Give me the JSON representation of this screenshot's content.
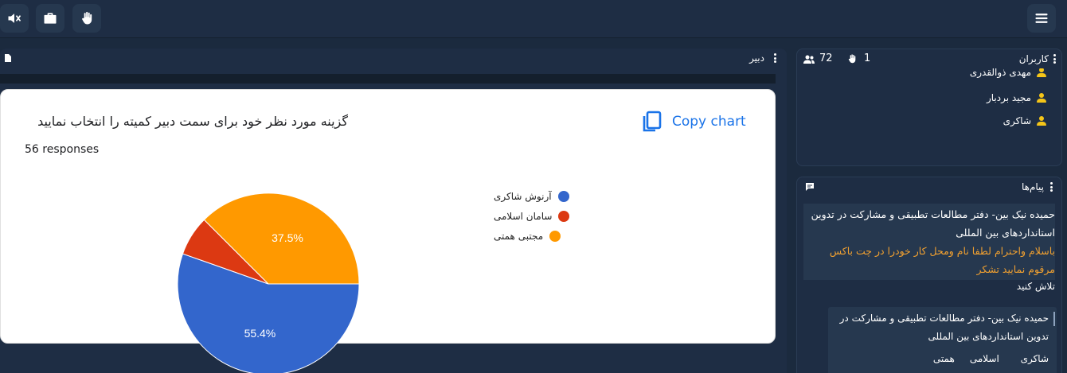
{
  "toolbar": {
    "buttons": [
      "speaker-muted-icon",
      "briefcase-icon",
      "raise-hand-icon"
    ],
    "menu_icon": "hamburger-icon"
  },
  "whiteboard_panel": {
    "title": "دبیر"
  },
  "chart_card": {
    "copy_label": "Copy chart",
    "question": "گزینه مورد نظر خود برای سمت دبیر کمیته را انتخاب نمایید",
    "responses": "56 responses",
    "colors": {
      "blue": "#3366cc",
      "red": "#dc3912",
      "orange": "#ff9900",
      "copy": "#1a73e8"
    }
  },
  "chart_data": {
    "type": "pie",
    "series": [
      {
        "name": "آرنوش شاکری",
        "value": 55.4,
        "label": "55.4%",
        "color": "#3366cc"
      },
      {
        "name": "سامان اسلامی",
        "value": 7.1,
        "label": "",
        "color": "#dc3912"
      },
      {
        "name": "مجتبی همتی",
        "value": 37.5,
        "label": "37.5%",
        "color": "#ff9900"
      }
    ],
    "legend_position": "right"
  },
  "users_panel": {
    "title": "کاربران",
    "user_count": "72",
    "hand_count": "1",
    "users": [
      "مهدی ذوالقدری",
      "مجید بردبار",
      "شاکری"
    ]
  },
  "messages_panel": {
    "title": "پیام‌ها",
    "pinned_sender": "حمیده نیک بین- دفتر مطالعات تطبیقی و مشارکت در تدوین استانداردهای بین المللی",
    "pinned_text": "باسلام واحترام لطفا نام ومحل کار خودرا در چت باکس مرقوم نمایید تشکر",
    "partial_text": "تلاش کنید",
    "second_sender": "حمیده نیک بین- دفتر مطالعات تطبیقی و مشارکت در تدوین استانداردهای بین المللی",
    "second_words": [
      "شاکری",
      "اسلامی",
      "همتی"
    ],
    "highlight_color": "#f0a030"
  }
}
